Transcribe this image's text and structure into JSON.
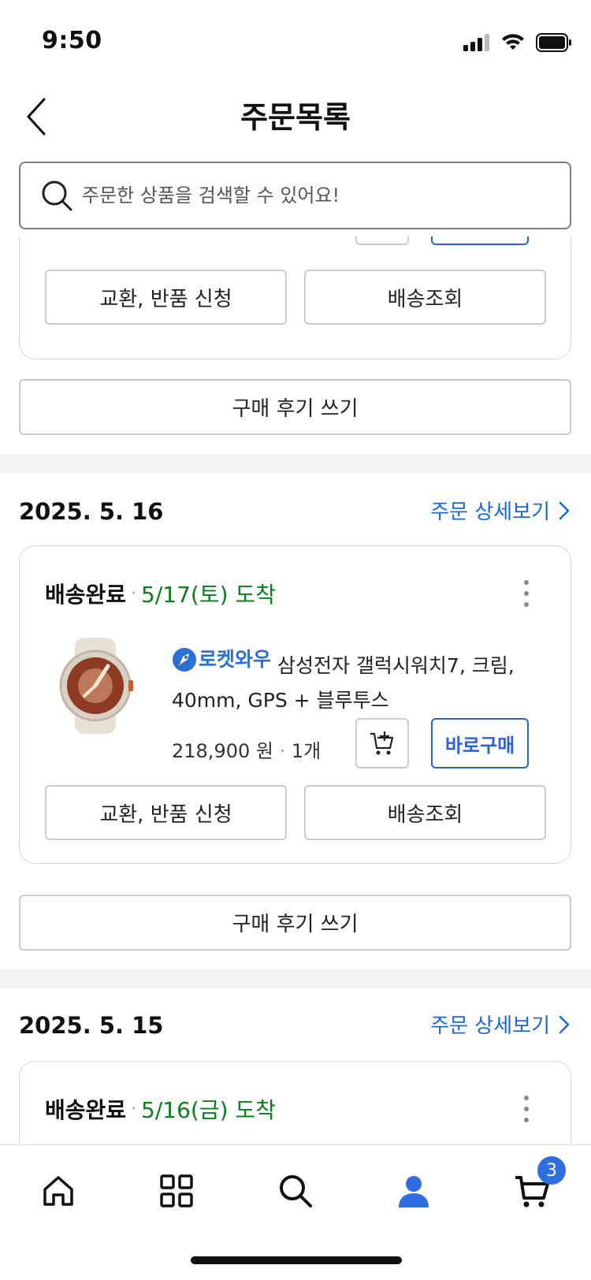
{
  "status_bar": {
    "time": "9:50"
  },
  "header": {
    "title": "주문목록"
  },
  "search": {
    "placeholder": "주문한 상품을 검색할 수 있어요!"
  },
  "top_partial_card": {
    "exchange_button": "교환, 반품 신청",
    "tracking_button": "배송조회",
    "review_button": "구매 후기 쓰기"
  },
  "orders": [
    {
      "date": "2025. 5. 16",
      "detail_link": "주문 상세보기",
      "status": "배송완료",
      "arrival": "5/17(토) 도착",
      "badge": "로켓와우",
      "product_name": "삼성전자 갤럭시워치7, 크림, 40mm, GPS + 블루투스",
      "price": "218,900 원",
      "quantity": "1개",
      "buy_now": "바로구매",
      "exchange_button": "교환, 반품 신청",
      "tracking_button": "배송조회",
      "review_button": "구매 후기 쓰기"
    },
    {
      "date": "2025. 5. 15",
      "detail_link": "주문 상세보기",
      "status": "배송완료",
      "arrival": "5/16(금) 도착"
    }
  ],
  "bottom_nav": {
    "items": [
      "home-icon",
      "category-icon",
      "search-icon",
      "mypage-icon",
      "cart-icon"
    ],
    "cart_badge": "3",
    "active": "mypage",
    "active_color": "#2f6ee0"
  }
}
